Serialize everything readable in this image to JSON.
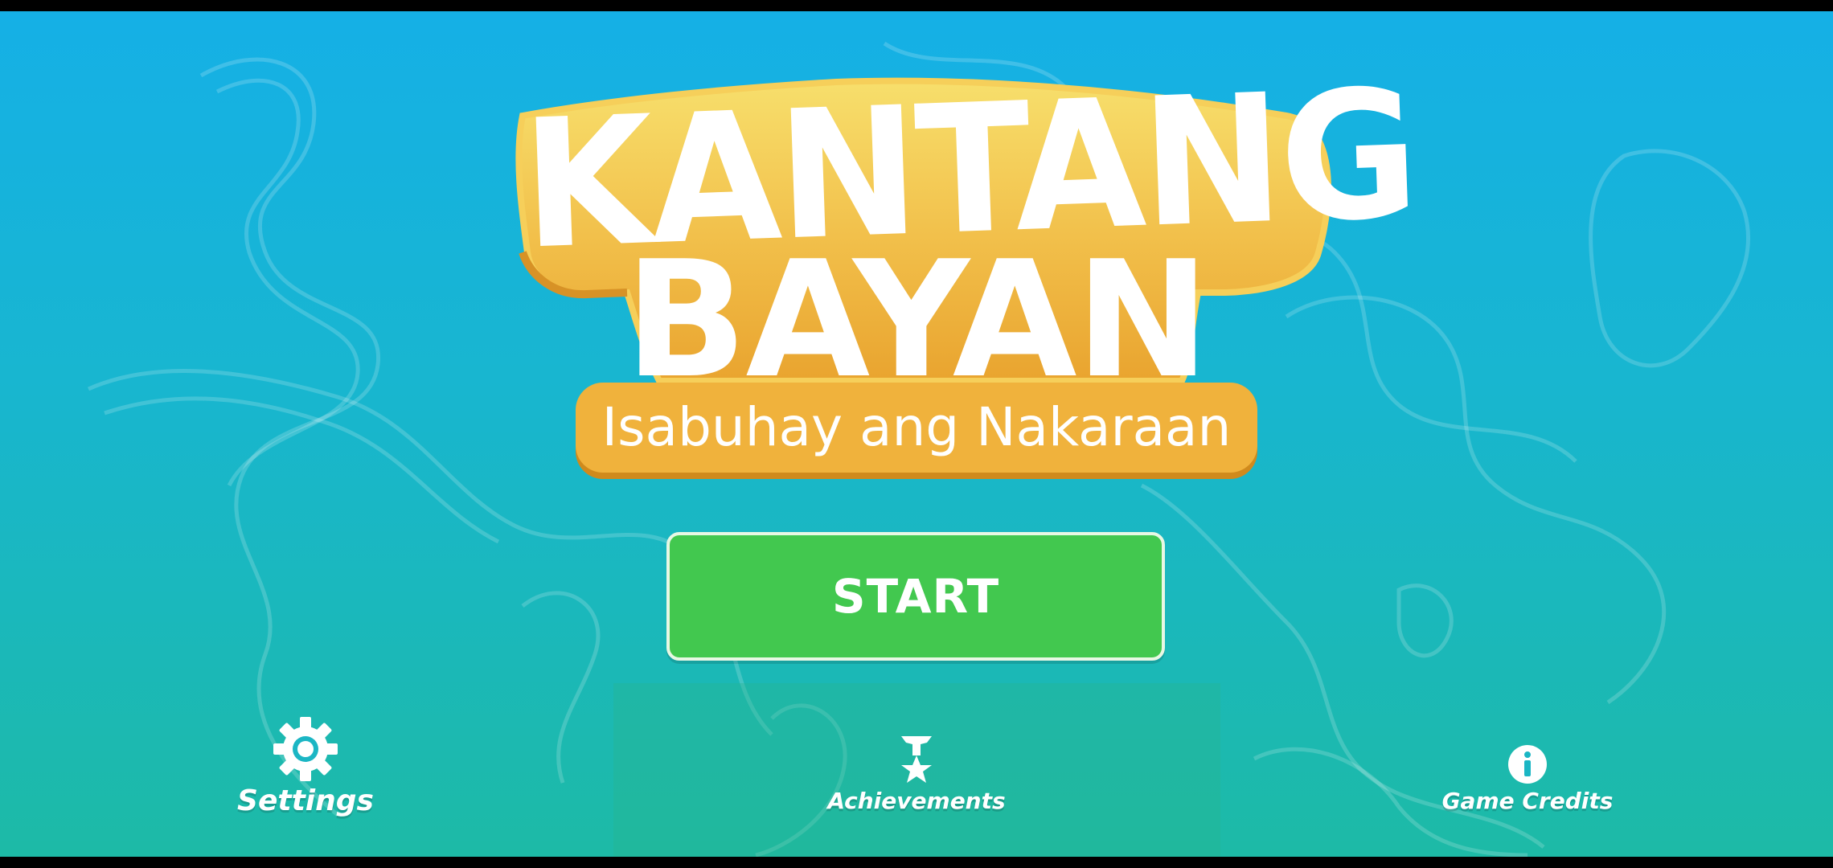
{
  "title": {
    "line1": "KANTANG",
    "line2": "BAYAN",
    "subtitle": "Isabuhay ang Nakaraan"
  },
  "start_button": {
    "label": "START"
  },
  "menu": {
    "settings": {
      "label": "Settings",
      "icon": "gear-icon"
    },
    "achievements": {
      "label": "Achievements",
      "icon": "trophy-icon"
    },
    "credits": {
      "label": "Game Credits",
      "icon": "info-icon"
    }
  },
  "colors": {
    "background_top": "#15b0e6",
    "background_bottom": "#1dbaa6",
    "logo_gold": "#f0b23c",
    "start_green": "#42c84f",
    "text_white": "#ffffff"
  }
}
